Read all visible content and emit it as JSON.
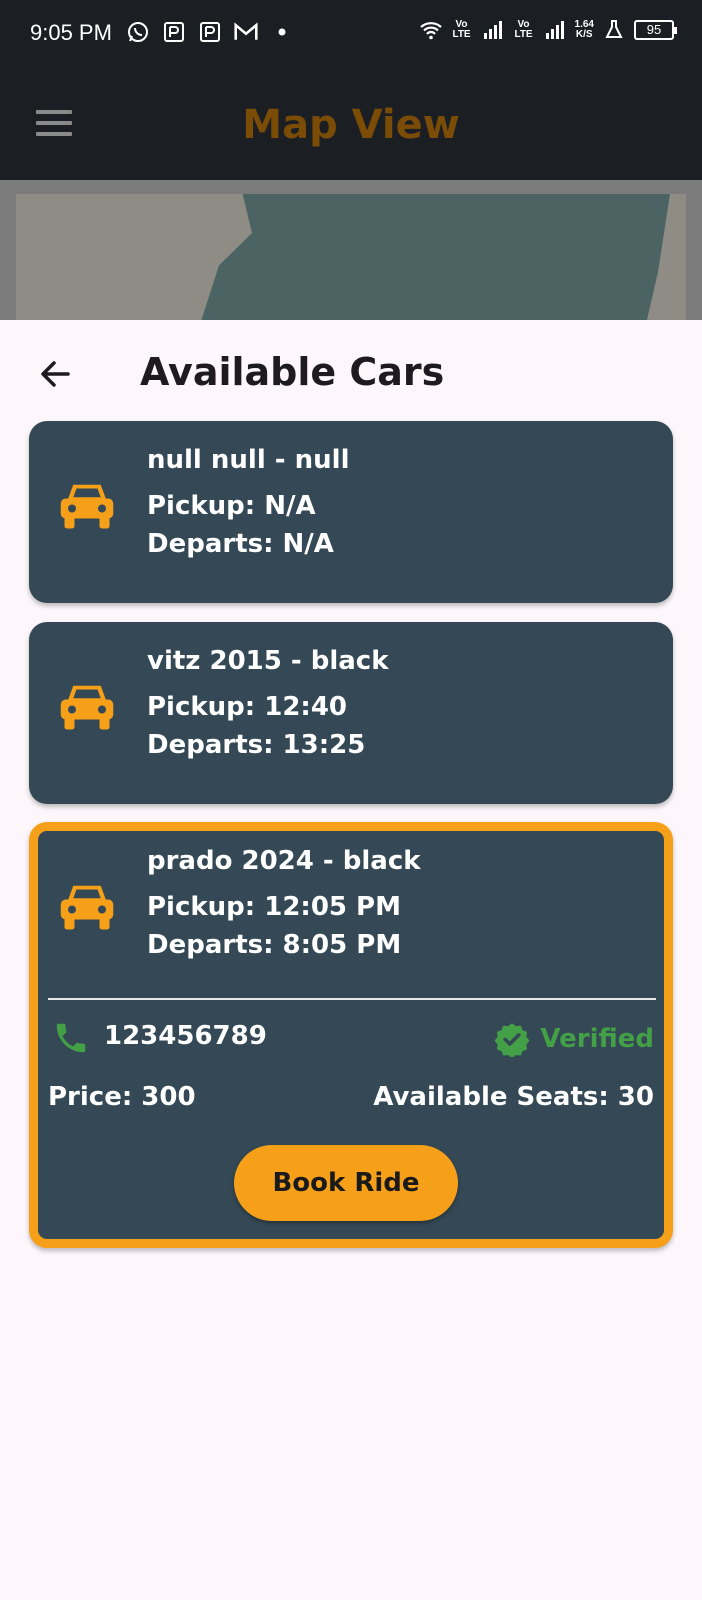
{
  "status_bar": {
    "time": "9:05 PM",
    "net_1": "Vo LTE",
    "net_2": "Vo LTE",
    "speed": "1.64",
    "speed_unit": "K/S",
    "battery": "95"
  },
  "app_bar": {
    "title": "Map View"
  },
  "sheet": {
    "title": "Available Cars"
  },
  "colors": {
    "accent": "#f6a01a",
    "card_bg": "#344955",
    "verified": "#43a047",
    "app_bar": "#1b1f24"
  },
  "cars": [
    {
      "name": "null null - null",
      "pickup": "Pickup: N/A",
      "departs": "Departs: N/A"
    },
    {
      "name": "vitz 2015 - black",
      "pickup": "Pickup: 12:40",
      "departs": "Departs: 13:25"
    },
    {
      "name": "prado 2024 - black",
      "pickup": "Pickup: 12:05 PM",
      "departs": "Departs: 8:05 PM",
      "phone": "123456789",
      "verified": "Verified",
      "price": "Price: 300",
      "seats": "Available Seats: 30",
      "book_label": "Book Ride"
    }
  ]
}
